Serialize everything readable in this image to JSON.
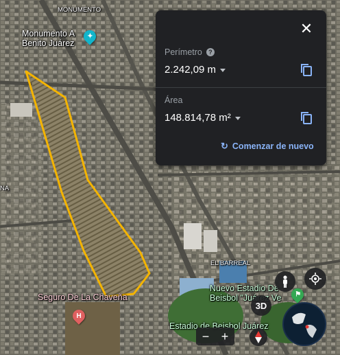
{
  "map": {
    "labels": {
      "monumento_top": "MONUMENTO",
      "monumento_line1": "Monumento A",
      "monumento_line2": "Benito Juárez",
      "left_edge": "NA",
      "seguro": "Seguro De La Chaveña",
      "el_barreal": "EL BARREAL",
      "estadio_nuevo_line1": "Nuevo Estadio De",
      "estadio_nuevo_line2": "Beisbol \"Juárez Ve",
      "estadio_beisbol": "Estadio de Beisbol Juárez"
    },
    "polygon_color": "#f4b400"
  },
  "panel": {
    "perimeter_label": "Perímetro",
    "perimeter_value": "2.242,09 m",
    "area_label": "Área",
    "area_value": "148.814,78 m²",
    "restart_label": "Comenzar de nuevo",
    "accent": "#8ab4f8"
  },
  "controls": {
    "three_d": "3D",
    "zoom_out": "−",
    "zoom_in": "+"
  }
}
